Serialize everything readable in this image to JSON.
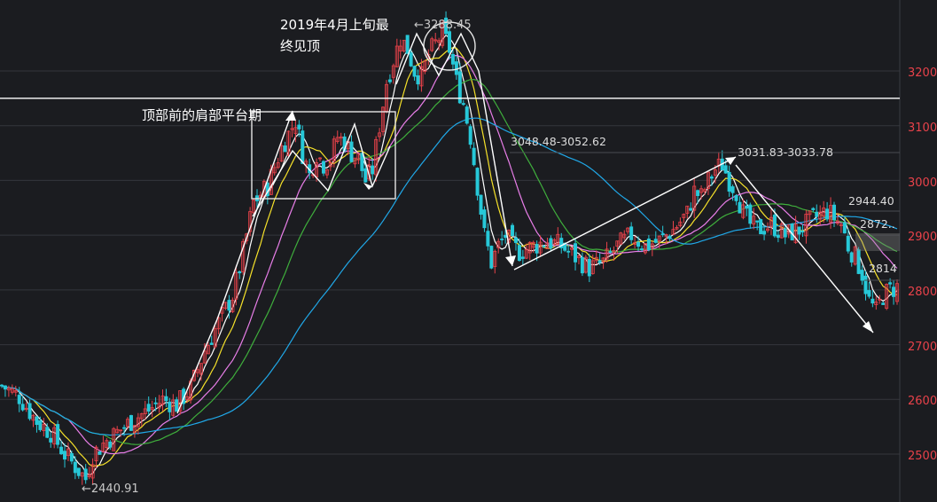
{
  "chart_data": {
    "type": "candlestick",
    "title": "",
    "xlabel": "",
    "ylabel": "",
    "ylim": [
      2430,
      3290
    ],
    "yticks": [
      2500,
      2600,
      2700,
      2800,
      2900,
      3000,
      3100,
      3200
    ],
    "grid": true,
    "colors": {
      "background": "#1b1c20",
      "up": "#e8424a",
      "down": "#27c8d8",
      "grid": "#34363c",
      "ma5": "#ffffff",
      "ma10": "#f5e12a",
      "ma20": "#e87ee8",
      "ma30": "#3fae3c",
      "ma60": "#20a8e8"
    },
    "moving_averages": [
      {
        "period": 5,
        "color": "#ffffff"
      },
      {
        "period": 10,
        "color": "#f5e12a"
      },
      {
        "period": 20,
        "color": "#e87ee8"
      },
      {
        "period": 30,
        "color": "#3fae3c"
      },
      {
        "period": 60,
        "color": "#20a8e8"
      }
    ],
    "close_path": [
      [
        0,
        2625
      ],
      [
        5,
        2605
      ],
      [
        10,
        2560
      ],
      [
        14,
        2540
      ],
      [
        18,
        2500
      ],
      [
        22,
        2470
      ],
      [
        24,
        2455
      ],
      [
        26,
        2500
      ],
      [
        30,
        2525
      ],
      [
        34,
        2545
      ],
      [
        38,
        2565
      ],
      [
        42,
        2580
      ],
      [
        46,
        2600
      ],
      [
        50,
        2590
      ],
      [
        54,
        2620
      ],
      [
        58,
        2690
      ],
      [
        62,
        2740
      ],
      [
        66,
        2790
      ],
      [
        68,
        2840
      ],
      [
        72,
        2960
      ],
      [
        76,
        2990
      ],
      [
        80,
        3060
      ],
      [
        84,
        3110
      ],
      [
        86,
        3050
      ],
      [
        88,
        3010
      ],
      [
        90,
        3050
      ],
      [
        92,
        3030
      ],
      [
        94,
        3040
      ],
      [
        96,
        3080
      ],
      [
        98,
        3070
      ],
      [
        100,
        3050
      ],
      [
        102,
        3040
      ],
      [
        104,
        3000
      ],
      [
        106,
        3020
      ],
      [
        108,
        3100
      ],
      [
        110,
        3180
      ],
      [
        112,
        3220
      ],
      [
        114,
        3260
      ],
      [
        116,
        3240
      ],
      [
        118,
        3200
      ],
      [
        120,
        3190
      ],
      [
        122,
        3230
      ],
      [
        124,
        3250
      ],
      [
        126,
        3270
      ],
      [
        128,
        3240
      ],
      [
        130,
        3180
      ],
      [
        132,
        3140
      ],
      [
        134,
        3080
      ],
      [
        136,
        2990
      ],
      [
        138,
        2900
      ],
      [
        140,
        2850
      ],
      [
        142,
        2880
      ],
      [
        144,
        2900
      ],
      [
        146,
        2880
      ],
      [
        148,
        2870
      ],
      [
        152,
        2880
      ],
      [
        156,
        2890
      ],
      [
        160,
        2880
      ],
      [
        164,
        2860
      ],
      [
        168,
        2840
      ],
      [
        172,
        2850
      ],
      [
        176,
        2880
      ],
      [
        180,
        2900
      ],
      [
        184,
        2880
      ],
      [
        188,
        2890
      ],
      [
        192,
        2910
      ],
      [
        196,
        2940
      ],
      [
        198,
        2980
      ],
      [
        200,
        2970
      ],
      [
        202,
        3000
      ],
      [
        204,
        3020
      ],
      [
        206,
        3030
      ],
      [
        208,
        3000
      ],
      [
        210,
        2980
      ],
      [
        212,
        2940
      ],
      [
        214,
        2920
      ],
      [
        216,
        2910
      ],
      [
        220,
        2920
      ],
      [
        224,
        2900
      ],
      [
        228,
        2910
      ],
      [
        232,
        2930
      ],
      [
        236,
        2944
      ],
      [
        240,
        2920
      ],
      [
        242,
        2880
      ],
      [
        244,
        2860
      ],
      [
        246,
        2830
      ],
      [
        248,
        2780
      ],
      [
        250,
        2760
      ],
      [
        252,
        2790
      ],
      [
        254,
        2800
      ],
      [
        256,
        2805
      ]
    ],
    "horizontal_lines": [
      {
        "value": 3150,
        "color": "#ffffff"
      },
      {
        "value": 3048.48,
        "color": "#555555"
      },
      {
        "value": 3031.83,
        "color": "#555555"
      },
      {
        "value": 2944.4,
        "color": "#555555"
      },
      {
        "value": 2814,
        "color": "#555555"
      }
    ],
    "annotations": {
      "peak_text_line1": "2019年4月上旬最",
      "peak_text_line2": "终见顶",
      "peak_value": "←3288.45",
      "shoulder_text": "顶部前的肩部平台期",
      "low_value": "←2440.91",
      "level_3048": "3048.48-3052.62",
      "level_3031": "3031.83-3033.78",
      "level_2944": "2944.40",
      "level_2872": "2872..",
      "level_2814": "2814"
    },
    "labels": {
      "tick_2500": "2500",
      "tick_2600": "2600",
      "tick_2700": "2700",
      "tick_2800": "2800",
      "tick_2900": "2900",
      "tick_3000": "3000",
      "tick_3100": "3100",
      "tick_3200": "3200"
    }
  }
}
